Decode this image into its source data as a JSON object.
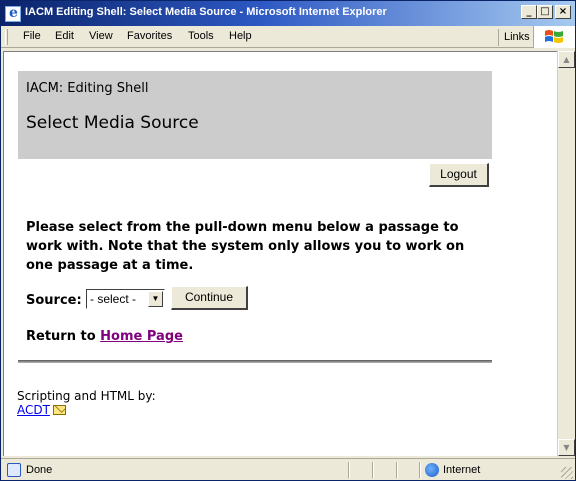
{
  "window": {
    "title": "IACM Editing Shell: Select Media Source - Microsoft Internet Explorer",
    "min_glyph": "_",
    "max_glyph": "□",
    "close_glyph": "×"
  },
  "menu": {
    "items": [
      {
        "label": "File"
      },
      {
        "label": "Edit"
      },
      {
        "label": "View"
      },
      {
        "label": "Favorites"
      },
      {
        "label": "Tools"
      },
      {
        "label": "Help"
      }
    ],
    "links_label": "Links"
  },
  "page": {
    "app_title": "IACM: Editing Shell",
    "title": "Select Media Source",
    "logout_label": "Logout",
    "instructions": "Please select from the pull-down menu below a passage to work with. Note that the system only allows you to work on one passage at a time.",
    "source_label": "Source:",
    "source_select_value": "- select -",
    "continue_label": "Continue",
    "return_text": "Return to",
    "home_link": "Home Page",
    "credits_text": "Scripting and HTML by:",
    "credits_link": "ACDT"
  },
  "status": {
    "text": "Done",
    "zone": "Internet"
  },
  "colors": {
    "header_bg": "#cccccc",
    "visited_link": "#800080",
    "link": "#0000ee"
  },
  "icons": [
    "ie-icon",
    "windows-flag-icon",
    "mail-icon",
    "page-done-icon",
    "internet-zone-icon"
  ]
}
